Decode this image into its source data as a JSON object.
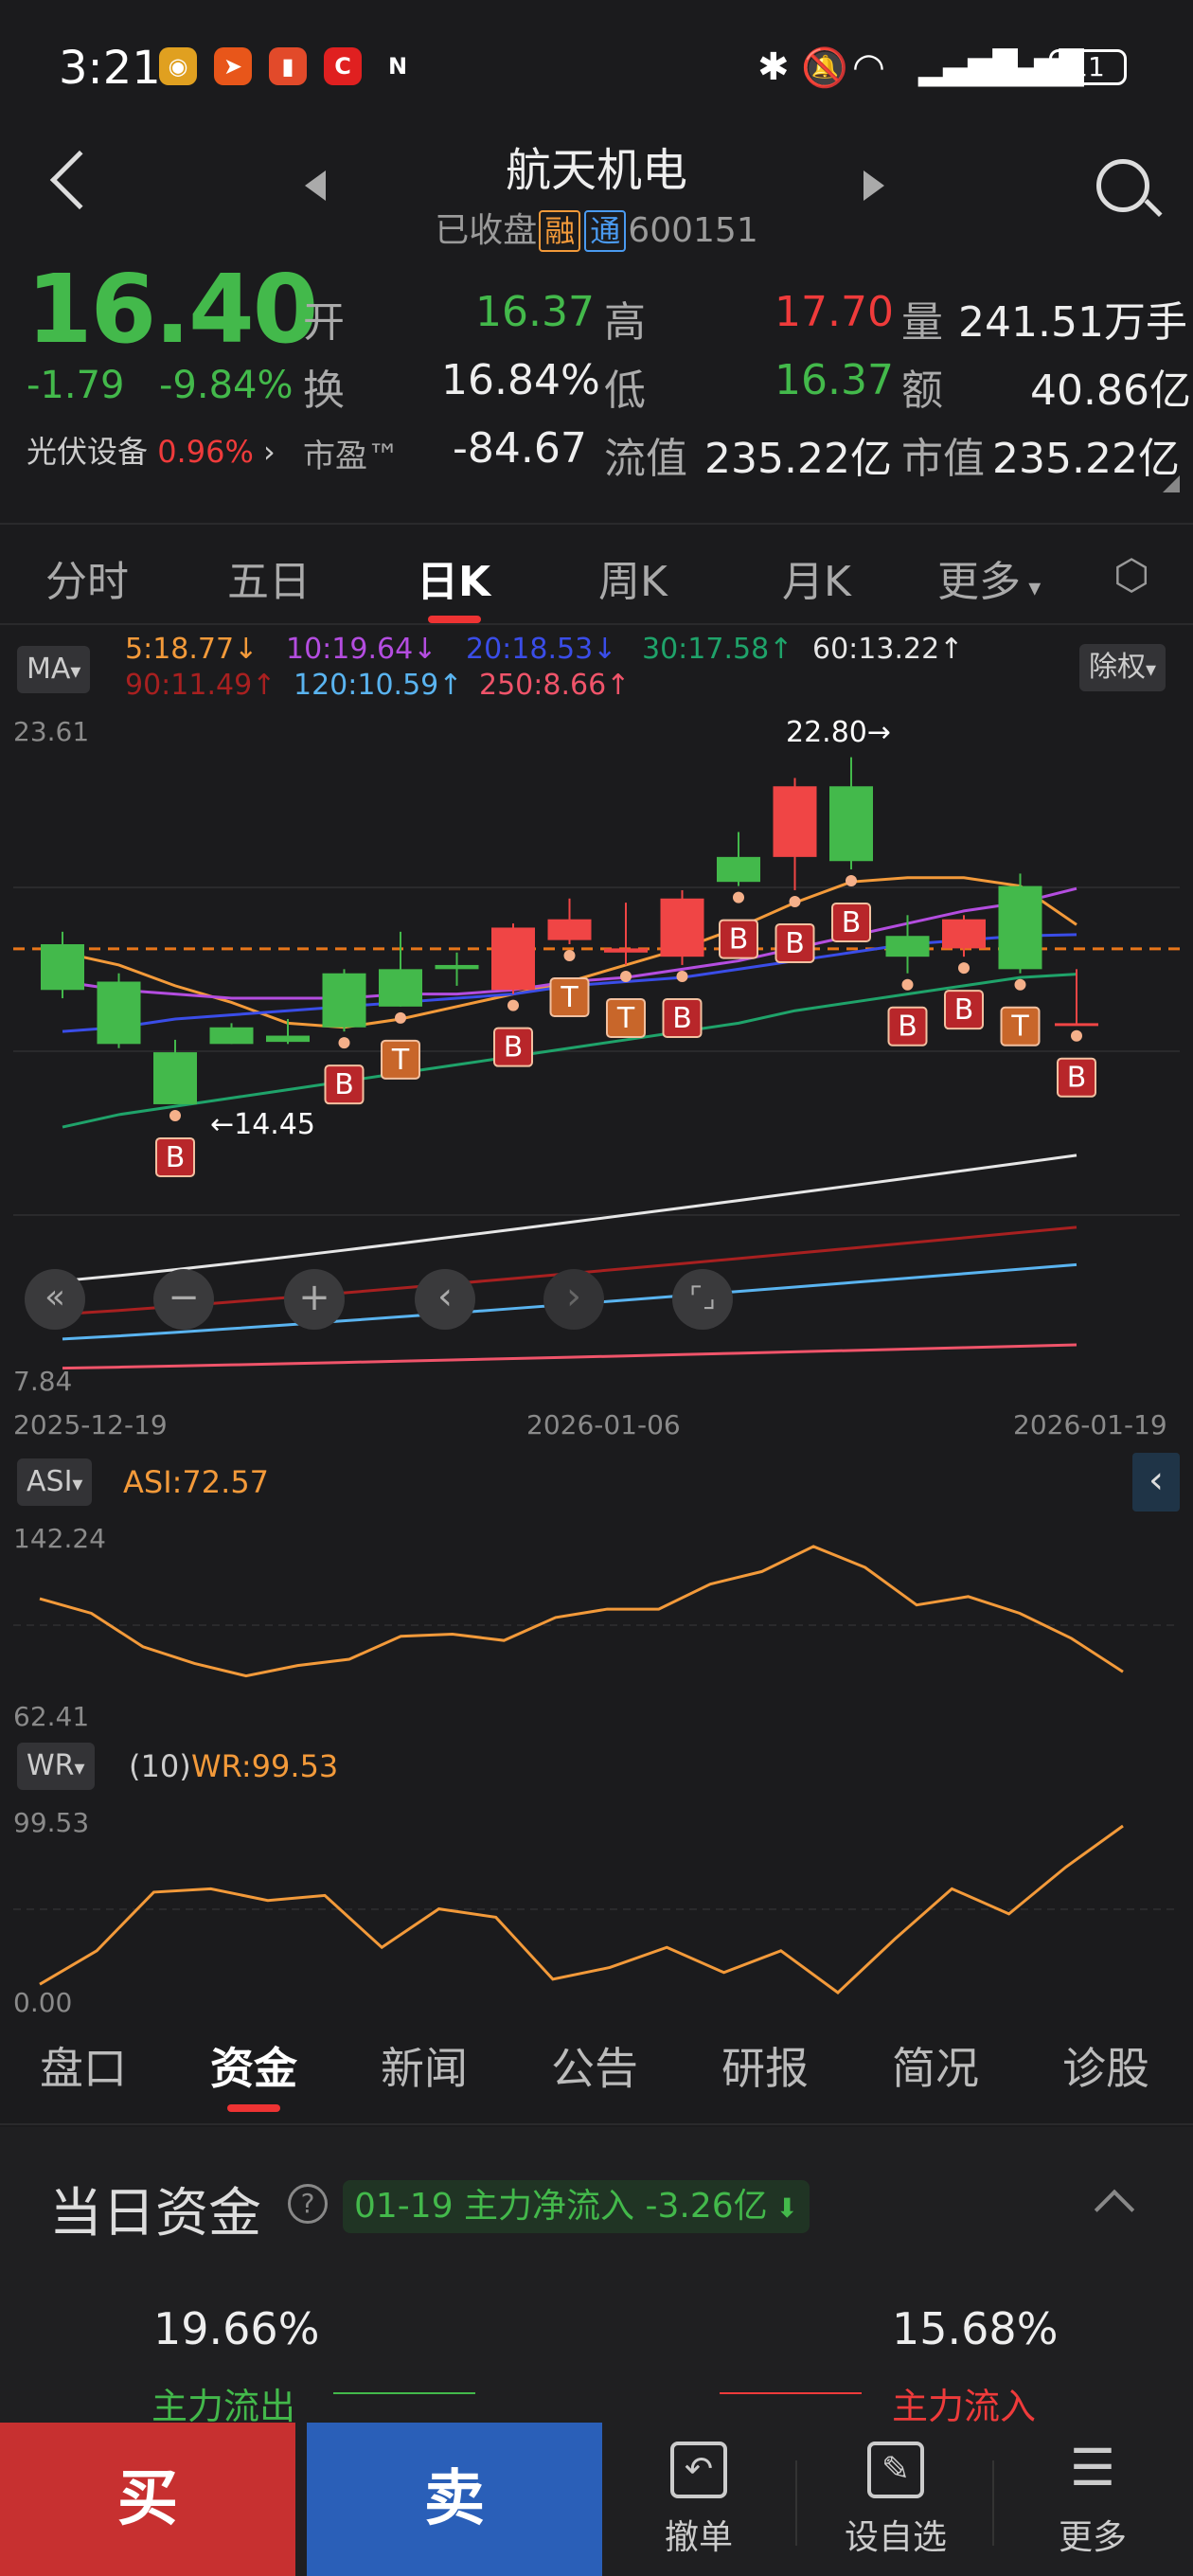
{
  "status": {
    "time": "3:21",
    "battery": "11",
    "app_icons": [
      {
        "name": "weibo-icon",
        "glyph": "◉",
        "color": "#e0a020"
      },
      {
        "name": "telegram-icon",
        "glyph": "➤",
        "color": "#e8561a"
      },
      {
        "name": "battery-alert-icon",
        "glyph": "▮",
        "color": "#e24a2a"
      },
      {
        "name": "c-app-icon",
        "glyph": "C",
        "color": "#e02020"
      },
      {
        "name": "nfc-icon",
        "glyph": "N",
        "color": "#ffffff"
      }
    ]
  },
  "header": {
    "name": "航天机电",
    "status": "已收盘",
    "tag_rong": "融",
    "tag_tong": "通",
    "code": "600151"
  },
  "quote": {
    "price": "16.40",
    "change": "-1.79",
    "change_pct": "-9.84%",
    "open_label": "开",
    "open": "16.37",
    "high_label": "高",
    "high": "17.70",
    "vol_label": "量",
    "vol": "241.51万手",
    "turn_label": "换",
    "turn": "16.84%",
    "low_label": "低",
    "low": "16.37",
    "amt_label": "额",
    "amt": "40.86亿",
    "pe_label": "市盈™",
    "pe": "-84.67",
    "float_label": "流值",
    "float": "235.22亿",
    "cap_label": "市值",
    "cap": "235.22亿",
    "sector": "光伏设备",
    "sector_pct": "0.96%"
  },
  "tabs": [
    "分时",
    "五日",
    "日K",
    "周K",
    "月K",
    "更多"
  ],
  "chart": {
    "ma_btn": "MA",
    "adj_btn": "除权",
    "ma": [
      {
        "label": "5:18.77↓",
        "color": "#f39a3a"
      },
      {
        "label": "10:19.64↓",
        "color": "#b44de0"
      },
      {
        "label": "20:18.53↓",
        "color": "#3a4de8"
      },
      {
        "label": "30:17.58↑",
        "color": "#1fa36a"
      },
      {
        "label": "60:13.22↑",
        "color": "#e6e6e6"
      },
      {
        "label": "90:11.49↑",
        "color": "#a82020"
      },
      {
        "label": "120:10.59↑",
        "color": "#5ab4f0"
      },
      {
        "label": "250:8.66↑",
        "color": "#f0546a"
      }
    ],
    "y_top": "23.61",
    "y_bottom": "7.84",
    "x_labels": [
      "2025-12-19",
      "2026-01-06",
      "2026-01-19"
    ],
    "high_note": "22.80→",
    "low_note": "←14.45",
    "signals": [
      "B",
      "B",
      "T",
      "B",
      "T",
      "T",
      "B",
      "B",
      "B",
      "B",
      "B",
      "B",
      "T",
      "B"
    ]
  },
  "chart_data": [
    {
      "type": "candlestick",
      "ylim": [
        7.84,
        23.61
      ],
      "x_labels": [
        "2025-12-19",
        "2026-01-06",
        "2026-01-19"
      ],
      "candles": [
        {
          "o": 18.3,
          "c": 17.2,
          "h": 18.6,
          "l": 17.0
        },
        {
          "o": 17.4,
          "c": 15.9,
          "h": 17.6,
          "l": 15.8
        },
        {
          "o": 15.7,
          "c": 14.45,
          "h": 16.0,
          "l": 14.45
        },
        {
          "o": 16.3,
          "c": 15.9,
          "h": 16.4,
          "l": 15.9
        },
        {
          "o": 16.1,
          "c": 15.95,
          "h": 16.5,
          "l": 15.9
        },
        {
          "o": 17.6,
          "c": 16.3,
          "h": 17.7,
          "l": 16.2
        },
        {
          "o": 17.7,
          "c": 16.8,
          "h": 18.6,
          "l": 16.8
        },
        {
          "o": 17.8,
          "c": 17.7,
          "h": 18.1,
          "l": 17.3
        },
        {
          "o": 17.2,
          "c": 18.7,
          "h": 18.8,
          "l": 17.1
        },
        {
          "o": 18.4,
          "c": 18.9,
          "h": 19.4,
          "l": 18.3
        },
        {
          "o": 18.1,
          "c": 18.2,
          "h": 19.3,
          "l": 17.8
        },
        {
          "o": 18.0,
          "c": 19.4,
          "h": 19.6,
          "l": 17.8
        },
        {
          "o": 20.4,
          "c": 19.8,
          "h": 21.0,
          "l": 19.7
        },
        {
          "o": 20.4,
          "c": 22.1,
          "h": 22.3,
          "l": 19.6
        },
        {
          "o": 22.1,
          "c": 20.3,
          "h": 22.8,
          "l": 20.1
        },
        {
          "o": 18.5,
          "c": 18.0,
          "h": 19.0,
          "l": 17.6
        },
        {
          "o": 18.2,
          "c": 18.9,
          "h": 19.0,
          "l": 18.0
        },
        {
          "o": 19.7,
          "c": 17.7,
          "h": 20.0,
          "l": 17.6
        },
        {
          "o": 16.4,
          "c": 16.4,
          "h": 17.7,
          "l": 16.37
        }
      ],
      "ma5": [
        18.1,
        17.8,
        17.3,
        16.9,
        16.4,
        16.3,
        16.5,
        16.8,
        17.1,
        17.4,
        17.8,
        18.2,
        18.7,
        19.3,
        19.8,
        19.9,
        19.9,
        19.7,
        18.77
      ],
      "ma10": [
        17.4,
        17.2,
        17.1,
        17.0,
        17.0,
        17.0,
        17.1,
        17.1,
        17.2,
        17.4,
        17.5,
        17.7,
        17.9,
        18.2,
        18.5,
        18.8,
        19.1,
        19.3,
        19.64
      ],
      "ma20": [
        16.2,
        16.3,
        16.5,
        16.6,
        16.7,
        16.8,
        16.9,
        17.0,
        17.1,
        17.3,
        17.4,
        17.5,
        17.7,
        17.9,
        18.1,
        18.3,
        18.4,
        18.5,
        18.53
      ],
      "ma30": [
        13.9,
        14.2,
        14.4,
        14.6,
        14.8,
        15.0,
        15.2,
        15.4,
        15.6,
        15.8,
        16.0,
        16.2,
        16.4,
        16.7,
        16.9,
        17.1,
        17.3,
        17.5,
        17.58
      ]
    },
    {
      "type": "line",
      "name": "ASI",
      "ylim": [
        62.41,
        142.24
      ],
      "current": "72.57",
      "values": [
        115,
        108,
        92,
        84,
        78,
        83,
        86,
        97,
        98,
        95,
        106,
        110,
        110,
        122,
        128,
        140,
        130,
        112,
        116,
        108,
        96,
        80
      ]
    },
    {
      "type": "line",
      "name": "WR",
      "param": "(10)",
      "ylim": [
        0.0,
        99.53
      ],
      "current": "99.53",
      "values": [
        5,
        25,
        60,
        62,
        55,
        58,
        27,
        50,
        45,
        8,
        15,
        27,
        12,
        25,
        0,
        32,
        62,
        47,
        75,
        99.53
      ]
    }
  ],
  "asi": {
    "btn": "ASI",
    "label": "ASI:72.57",
    "top": "142.24",
    "bottom": "62.41"
  },
  "wr": {
    "btn": "WR",
    "param": "(10)",
    "label": "WR:99.53",
    "top": "99.53",
    "bottom": "0.00"
  },
  "info_tabs": [
    "盘口",
    "资金",
    "新闻",
    "公告",
    "研报",
    "简况",
    "诊股"
  ],
  "funds": {
    "title": "当日资金",
    "flow": "01-19 主力净流入 -3.26亿",
    "out_pct": "19.66%",
    "out_label": "主力流出",
    "in_pct": "15.68%",
    "in_label": "主力流入"
  },
  "actions": {
    "buy": "买",
    "sell": "卖",
    "cancel": "撤单",
    "watch": "设自选",
    "more": "更多"
  }
}
